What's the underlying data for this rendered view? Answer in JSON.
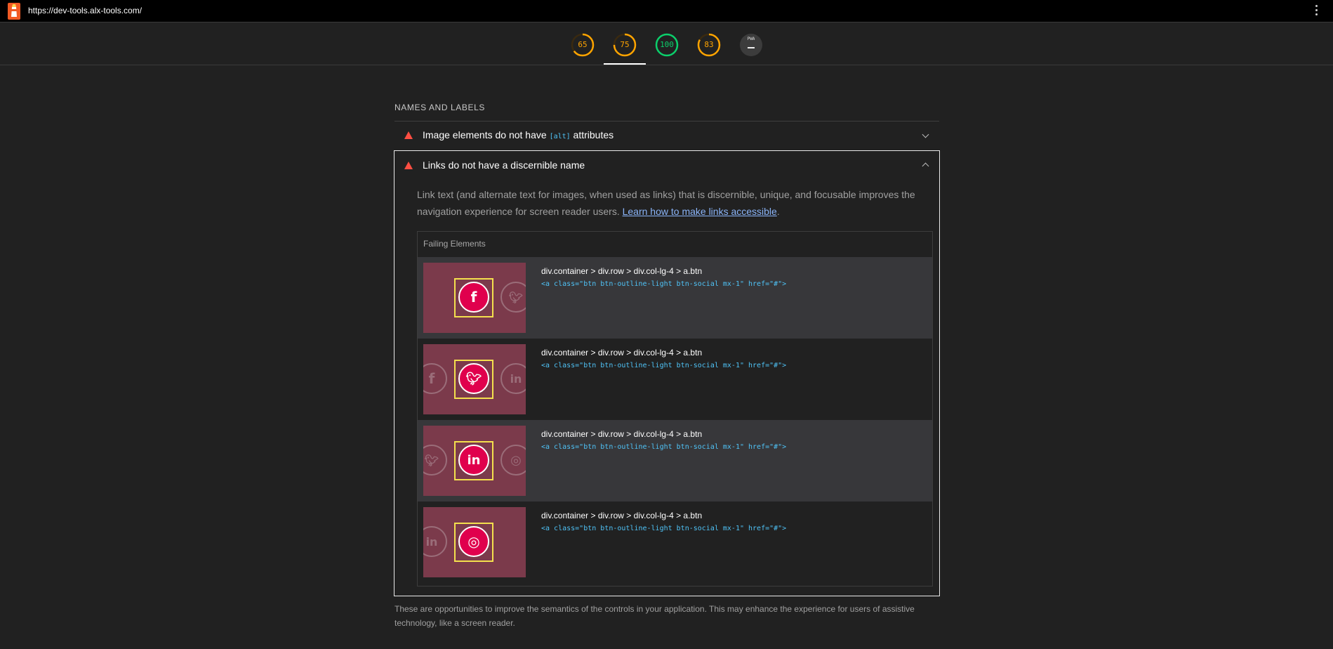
{
  "browser": {
    "url": "https://dev-tools.alx-tools.com/",
    "icons": {
      "logo": "lighthouse-icon",
      "menu": "more-vert-icon"
    }
  },
  "scores": [
    {
      "value": "65",
      "color": "#ffa400",
      "fraction": 0.65
    },
    {
      "value": "75",
      "color": "#ffa400",
      "fraction": 0.75
    },
    {
      "value": "100",
      "color": "#0cce6b",
      "fraction": 1.0
    },
    {
      "value": "83",
      "color": "#ffa400",
      "fraction": 0.83
    },
    {
      "value": "PWA",
      "color": "#9e9e9e",
      "fraction": 0
    }
  ],
  "section": {
    "title": "NAMES AND LABELS",
    "audits": [
      {
        "title_before": "Image elements do not have ",
        "code": "[alt]",
        "title_after": " attributes",
        "expanded": false
      },
      {
        "title": "Links do not have a discernible name",
        "expanded": true
      }
    ]
  },
  "details": {
    "description": "Link text (and alternate text for images, when used as links) that is discernible, unique, and focusable improves the navigation experience for screen reader users. ",
    "learn_link": "Learn how to make links accessible",
    "after_link": ".",
    "table_header": "Failing Elements",
    "rows": [
      {
        "selector": "div.container > div.row > div.col-lg-4 > a.btn",
        "snippet": "<a class=\"btn btn-outline-light btn-social mx-1\" href=\"#\">",
        "icon": "facebook-icon"
      },
      {
        "selector": "div.container > div.row > div.col-lg-4 > a.btn",
        "snippet": "<a class=\"btn btn-outline-light btn-social mx-1\" href=\"#\">",
        "icon": "twitter-icon"
      },
      {
        "selector": "div.container > div.row > div.col-lg-4 > a.btn",
        "snippet": "<a class=\"btn btn-outline-light btn-social mx-1\" href=\"#\">",
        "icon": "linkedin-icon"
      },
      {
        "selector": "div.container > div.row > div.col-lg-4 > a.btn",
        "snippet": "<a class=\"btn btn-outline-light btn-social mx-1\" href=\"#\">",
        "icon": "dribbble-icon"
      }
    ]
  },
  "footer_note": "These are opportunities to improve the semantics of the controls in your application. This may enhance the experience for users of assistive technology, like a screen reader."
}
